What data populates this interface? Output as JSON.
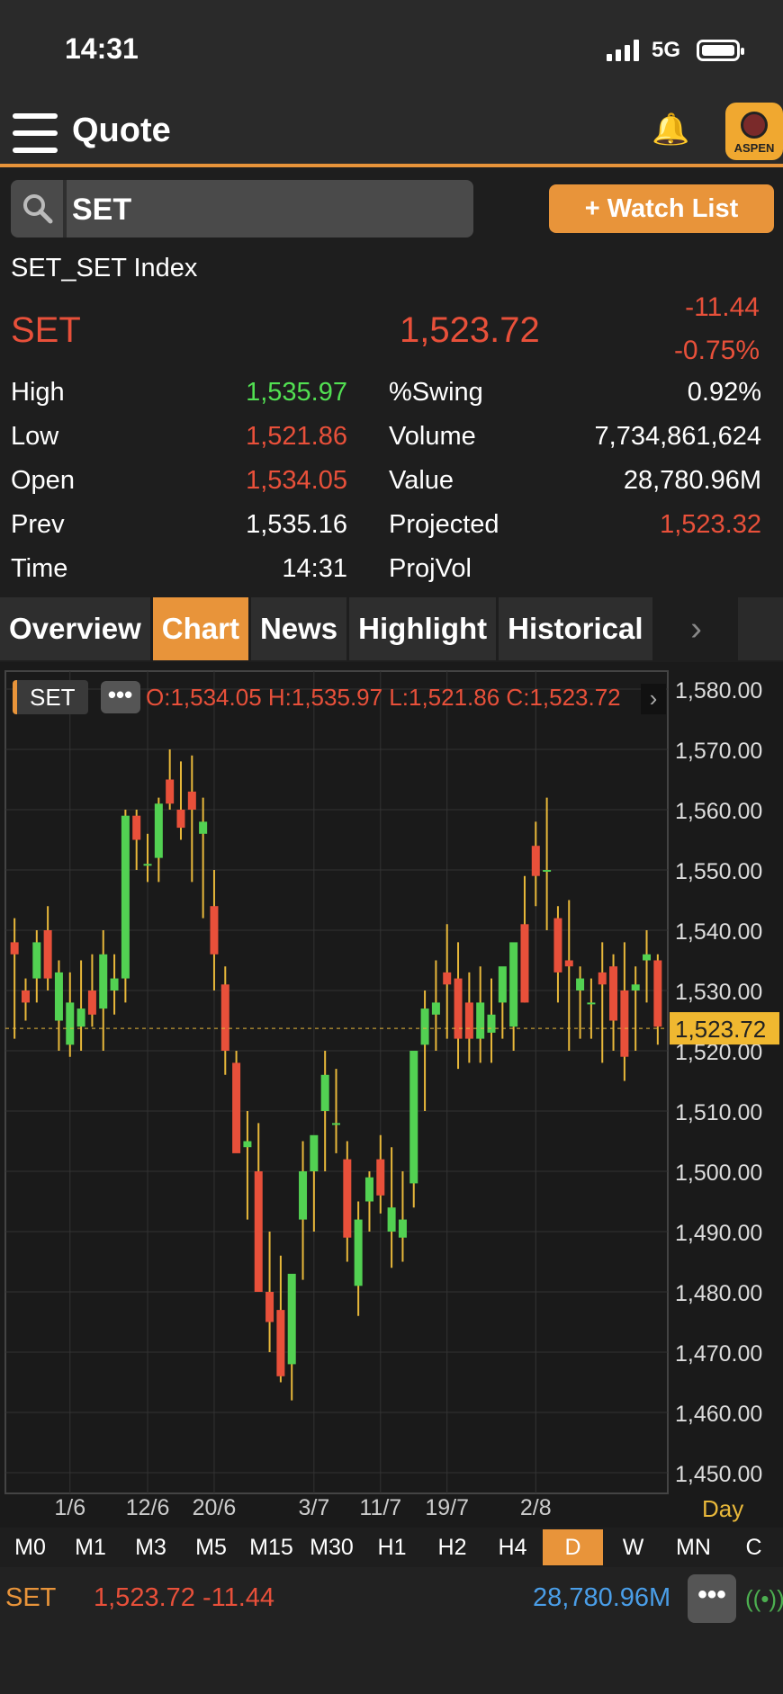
{
  "status_bar": {
    "time": "14:31",
    "network": "5G"
  },
  "header": {
    "title": "Quote",
    "logo_text": "ASPEN"
  },
  "search": {
    "value": "SET",
    "watchlist_button": "+ Watch List"
  },
  "quote": {
    "full_name": "SET_SET Index",
    "symbol": "SET",
    "last": "1,523.72",
    "change": "-11.44",
    "change_pct": "-0.75%",
    "left_stats": [
      {
        "label": "High",
        "value": "1,535.97",
        "color": "#52e052"
      },
      {
        "label": "Low",
        "value": "1,521.86",
        "color": "#e8503a"
      },
      {
        "label": "Open",
        "value": "1,534.05",
        "color": "#e8503a"
      },
      {
        "label": "Prev",
        "value": "1,535.16",
        "color": "#ffffff"
      },
      {
        "label": "Time",
        "value": "14:31",
        "color": "#ffffff"
      }
    ],
    "right_stats": [
      {
        "label": "%Swing",
        "value": "0.92%",
        "color": "#ffffff"
      },
      {
        "label": "Volume",
        "value": "7,734,861,624",
        "color": "#ffffff"
      },
      {
        "label": "Value",
        "value": "28,780.96M",
        "color": "#ffffff"
      },
      {
        "label": "Projected",
        "value": "1,523.32",
        "color": "#e8503a"
      },
      {
        "label": "ProjVol",
        "value": "",
        "color": "#ffffff"
      }
    ]
  },
  "tabs": [
    "Overview",
    "Chart",
    "News",
    "Highlight",
    "Historical"
  ],
  "active_tab": "Chart",
  "chart_legend": {
    "symbol": "SET",
    "ohlc": "O:1,534.05  H:1,535.97  L:1,521.86  C:1,523.72"
  },
  "chart_data": {
    "type": "candlestick",
    "y_ticks": [
      "1,580.00",
      "1,570.00",
      "1,560.00",
      "1,550.00",
      "1,540.00",
      "1,530.00",
      "1,520.00",
      "1,510.00",
      "1,500.00",
      "1,490.00",
      "1,480.00",
      "1,470.00",
      "1,460.00",
      "1,450.00"
    ],
    "ylim": [
      1450,
      1580
    ],
    "x_ticks": [
      {
        "label": "1/6",
        "index": 5
      },
      {
        "label": "12/6",
        "index": 12
      },
      {
        "label": "20/6",
        "index": 18
      },
      {
        "label": "3/7",
        "index": 27
      },
      {
        "label": "11/7",
        "index": 33
      },
      {
        "label": "19/7",
        "index": 39
      },
      {
        "label": "2/8",
        "index": 47
      }
    ],
    "period_label": "Day",
    "last_price_label": "1,523.72",
    "last_price": 1523.72,
    "up_color": "#52d152",
    "down_color": "#e8503a",
    "candles": [
      [
        1538,
        1542,
        1522,
        1536
      ],
      [
        1530,
        1532,
        1525,
        1528
      ],
      [
        1532,
        1540,
        1528,
        1538
      ],
      [
        1540,
        1544,
        1530,
        1532
      ],
      [
        1525,
        1535,
        1520,
        1533
      ],
      [
        1521,
        1533,
        1519,
        1528
      ],
      [
        1524,
        1535,
        1520,
        1527
      ],
      [
        1530,
        1536,
        1524,
        1526
      ],
      [
        1527,
        1540,
        1520,
        1536
      ],
      [
        1530,
        1536,
        1526,
        1532
      ],
      [
        1532,
        1560,
        1528,
        1559
      ],
      [
        1559,
        1560,
        1550,
        1555
      ],
      [
        1551,
        1556,
        1548,
        1551
      ],
      [
        1552,
        1562,
        1548,
        1561
      ],
      [
        1565,
        1570,
        1560,
        1561
      ],
      [
        1560,
        1568,
        1555,
        1557
      ],
      [
        1563,
        1569,
        1548,
        1560
      ],
      [
        1556,
        1562,
        1542,
        1558
      ],
      [
        1544,
        1550,
        1530,
        1536
      ],
      [
        1531,
        1534,
        1516,
        1520
      ],
      [
        1518,
        1520,
        1505,
        1503
      ],
      [
        1504,
        1510,
        1492,
        1505
      ],
      [
        1500,
        1508,
        1484,
        1480
      ],
      [
        1480,
        1490,
        1470,
        1475
      ],
      [
        1477,
        1486,
        1465,
        1466
      ],
      [
        1468,
        1480,
        1462,
        1483
      ],
      [
        1492,
        1505,
        1482,
        1500
      ],
      [
        1500,
        1505,
        1490,
        1506
      ],
      [
        1510,
        1520,
        1500,
        1516
      ],
      [
        1508,
        1517,
        1503,
        1508
      ],
      [
        1502,
        1505,
        1485,
        1489
      ],
      [
        1481,
        1495,
        1476,
        1492
      ],
      [
        1495,
        1500,
        1490,
        1499
      ],
      [
        1502,
        1506,
        1493,
        1496
      ],
      [
        1490,
        1504,
        1484,
        1494
      ],
      [
        1489,
        1500,
        1485,
        1492
      ],
      [
        1498,
        1520,
        1494,
        1520
      ],
      [
        1521,
        1530,
        1510,
        1527
      ],
      [
        1526,
        1535,
        1520,
        1528
      ],
      [
        1533,
        1541,
        1522,
        1531
      ],
      [
        1532,
        1538,
        1517,
        1522
      ],
      [
        1528,
        1533,
        1518,
        1522
      ],
      [
        1522,
        1534,
        1518,
        1528
      ],
      [
        1523,
        1532,
        1518,
        1526
      ],
      [
        1528,
        1530,
        1522,
        1534
      ],
      [
        1524,
        1535,
        1520,
        1538
      ],
      [
        1541,
        1549,
        1528,
        1528
      ],
      [
        1554,
        1558,
        1544,
        1549
      ],
      [
        1550,
        1562,
        1540,
        1550
      ],
      [
        1542,
        1544,
        1528,
        1533
      ],
      [
        1535,
        1545,
        1520,
        1534
      ],
      [
        1530,
        1534,
        1522,
        1532
      ],
      [
        1528,
        1532,
        1522,
        1528
      ],
      [
        1533,
        1538,
        1518,
        1531
      ],
      [
        1534,
        1536,
        1520,
        1525
      ],
      [
        1530,
        1538,
        1515,
        1519
      ],
      [
        1530,
        1534,
        1520,
        1531
      ],
      [
        1535,
        1540,
        1528,
        1536
      ],
      [
        1535,
        1536,
        1521,
        1524
      ]
    ]
  },
  "periods": [
    "M0",
    "M1",
    "M3",
    "M5",
    "M15",
    "M30",
    "H1",
    "H2",
    "H4",
    "D",
    "W",
    "MN",
    "C"
  ],
  "active_period": "D",
  "footer": {
    "symbol": "SET",
    "last_change": "1,523.72 -11.44",
    "value": "28,780.96M"
  }
}
